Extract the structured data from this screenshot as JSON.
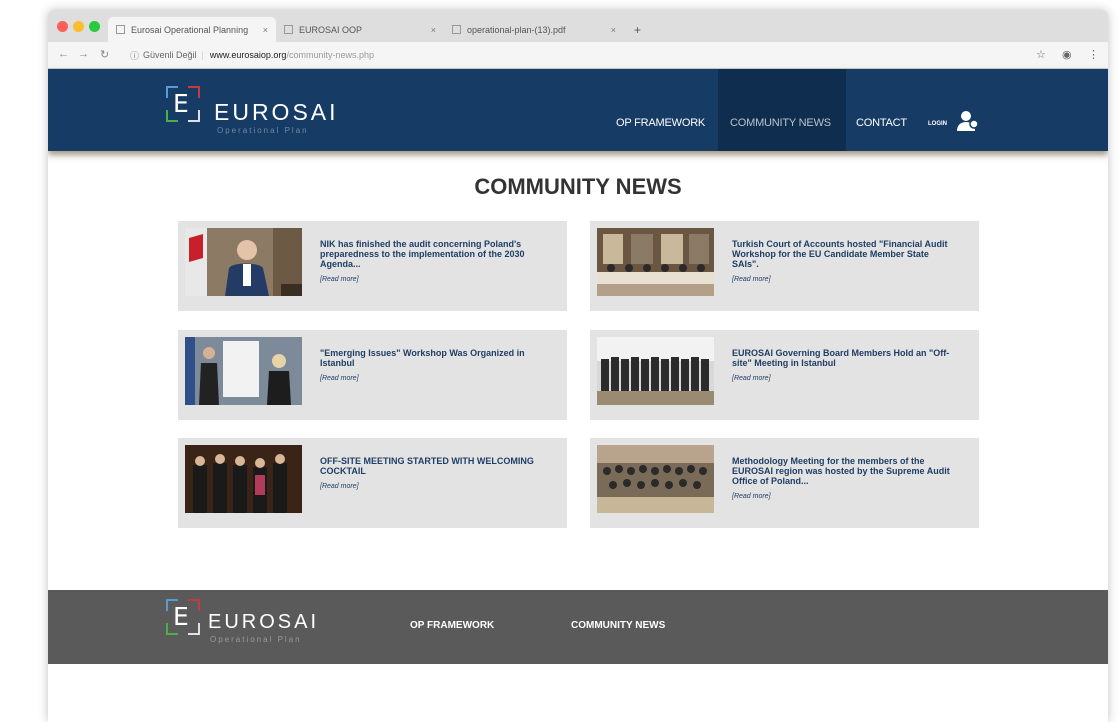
{
  "browser": {
    "tabs": [
      {
        "label": "Eurosai Operational Planning"
      },
      {
        "label": "EUROSAI OOP"
      },
      {
        "label": "operational-plan-(13).pdf"
      }
    ],
    "new_tab": "+",
    "security_label": "Güvenli Değil",
    "url_domain": "www.eurosaiop.org",
    "url_path": "/community-news.php"
  },
  "site": {
    "logo_letter": "E",
    "logo_word": "EUROSAI",
    "logo_sub": "Operational Plan",
    "nav": [
      {
        "label": "OP FRAMEWORK"
      },
      {
        "label": "COMMUNITY NEWS"
      },
      {
        "label": "CONTACT"
      }
    ],
    "login_label": "LOGIN"
  },
  "main": {
    "title": "COMMUNITY NEWS",
    "read_more": "[Read more]",
    "news": [
      {
        "title": "NIK has finished the audit concerning Poland's preparedness to the implementation of the 2030 Agenda..."
      },
      {
        "title": "Turkish Court of Accounts hosted \"Financial Audit Workshop for the EU Candidate Member State SAIs\"."
      },
      {
        "title": "\"Emerging Issues\" Workshop Was Organized in Istanbul"
      },
      {
        "title": "EUROSAI Governing Board Members Hold an \"Off-site\" Meeting in Istanbul"
      },
      {
        "title": "OFF-SITE MEETING STARTED WITH WELCOMING COCKTAIL"
      },
      {
        "title": "Methodology Meeting for the members of the EUROSAI region was hosted by the Supreme Audit Office of Poland..."
      }
    ]
  },
  "footer": {
    "links": [
      {
        "label": "OP FRAMEWORK"
      },
      {
        "label": "COMMUNITY NEWS"
      }
    ]
  },
  "colors": {
    "header_bg": "#163b64",
    "footer_bg": "#5a5a5a",
    "card_bg": "#e3e3e3",
    "news_title": "#1f3e66"
  }
}
